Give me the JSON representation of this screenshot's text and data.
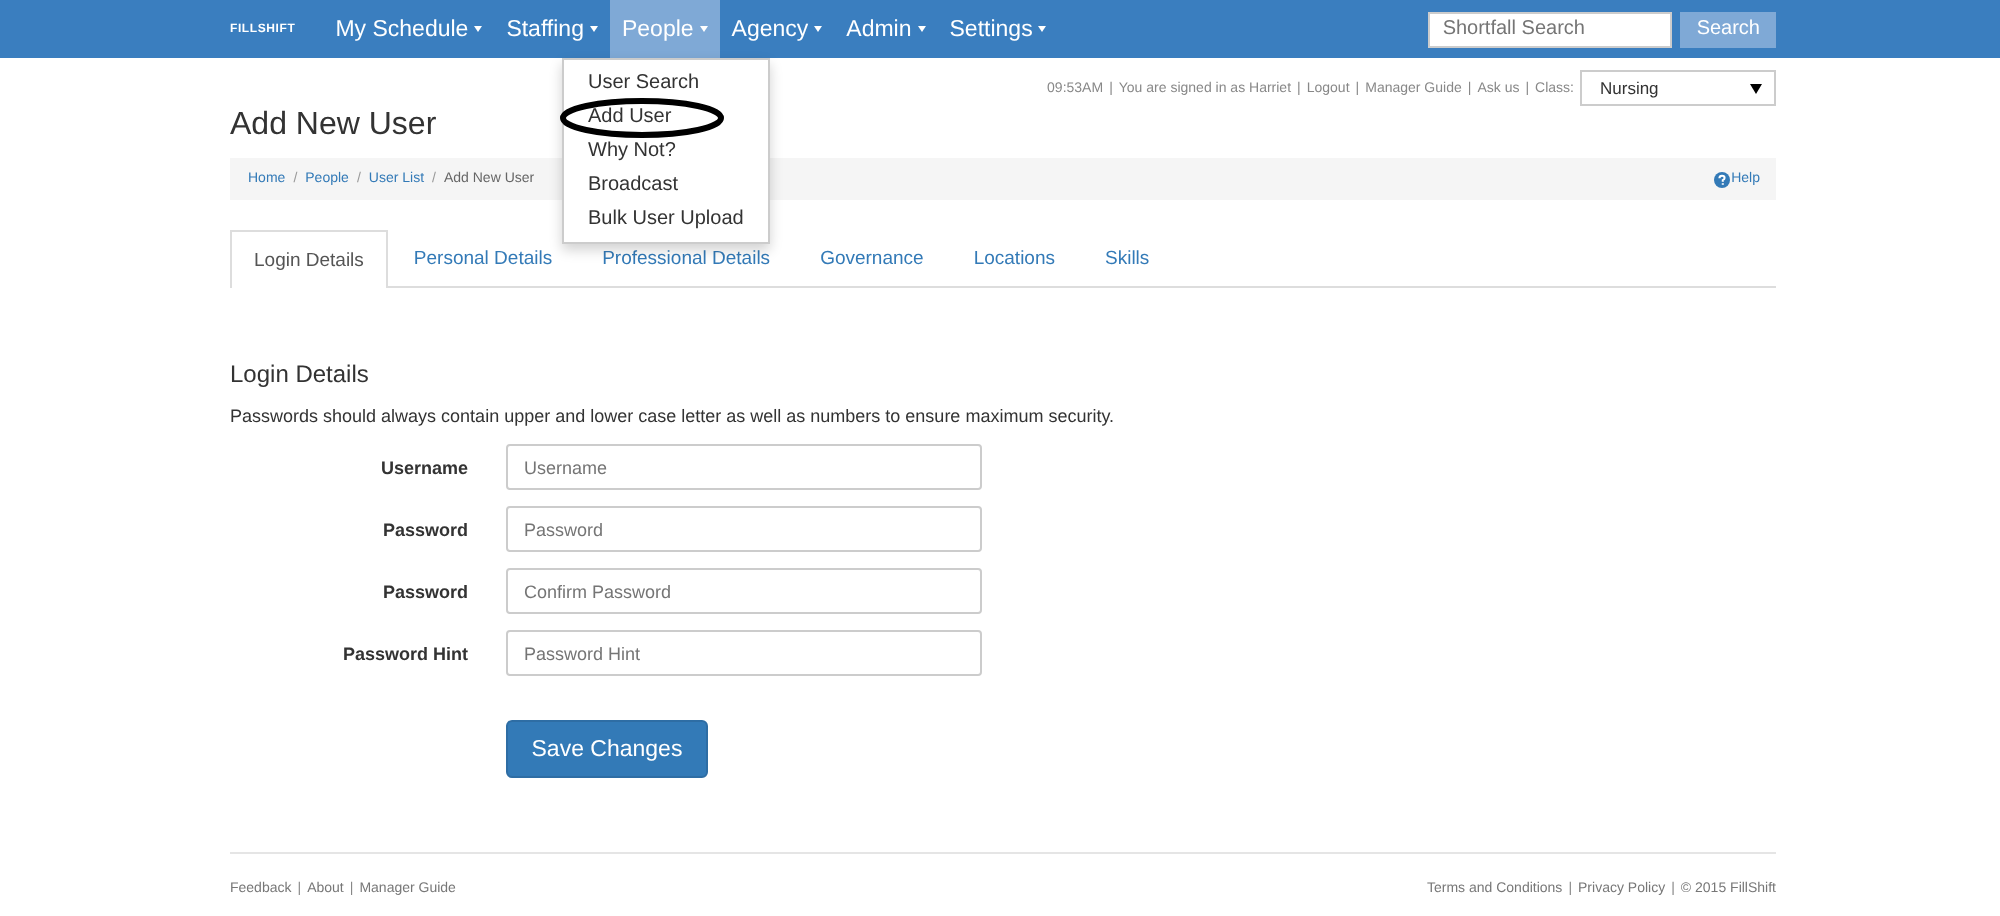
{
  "navbar": {
    "brand": "FILLSHIFT",
    "items": [
      {
        "label": "My Schedule",
        "selected": false
      },
      {
        "label": "Staffing",
        "selected": false
      },
      {
        "label": "People",
        "selected": true
      },
      {
        "label": "Agency",
        "selected": false
      },
      {
        "label": "Admin",
        "selected": false
      },
      {
        "label": "Settings",
        "selected": false
      }
    ],
    "search": {
      "placeholder": "Shortfall Search"
    },
    "search_button": "Search"
  },
  "people_menu": {
    "items": [
      {
        "label": "User Search",
        "circled": false
      },
      {
        "label": "Add User",
        "circled": true
      },
      {
        "label": "Why Not?",
        "circled": false
      },
      {
        "label": "Broadcast",
        "circled": false
      },
      {
        "label": "Bulk User Upload",
        "circled": false
      }
    ]
  },
  "status_line": {
    "time": "09:53AM",
    "signed_in": "You are signed in as Harriet",
    "separator": "|",
    "links": [
      "Logout",
      "Manager Guide",
      "Ask us"
    ],
    "class_label": "Class:",
    "class_value": "Nursing"
  },
  "page_title": "Add New User",
  "breadcrumb": [
    "Home",
    "People",
    "User List",
    "Add New User"
  ],
  "breadcrumb_separator": "/",
  "help": "Help",
  "tabs": [
    {
      "label": "Login Details",
      "selected": true
    },
    {
      "label": "Personal Details",
      "selected": false
    },
    {
      "label": "Professional Details",
      "selected": false
    },
    {
      "label": "Governance",
      "selected": false
    },
    {
      "label": "Locations",
      "selected": false
    },
    {
      "label": "Skills",
      "selected": false
    }
  ],
  "section_title": "Login Details",
  "note": "Passwords should always contain upper and lower case letter as well as numbers to ensure maximum security.",
  "fields": [
    {
      "label": "Username",
      "placeholder": "Username"
    },
    {
      "label": "Password",
      "placeholder": "Password"
    },
    {
      "label": "Password",
      "placeholder": "Confirm Password"
    },
    {
      "label": "Password Hint",
      "placeholder": "Password Hint"
    }
  ],
  "save_button": "Save Changes",
  "footer": {
    "separator": "|",
    "left": [
      "Feedback",
      "About",
      "Manager Guide"
    ],
    "right": [
      "Terms and Conditions",
      "Privacy Policy",
      "© 2015 FillShift"
    ]
  }
}
